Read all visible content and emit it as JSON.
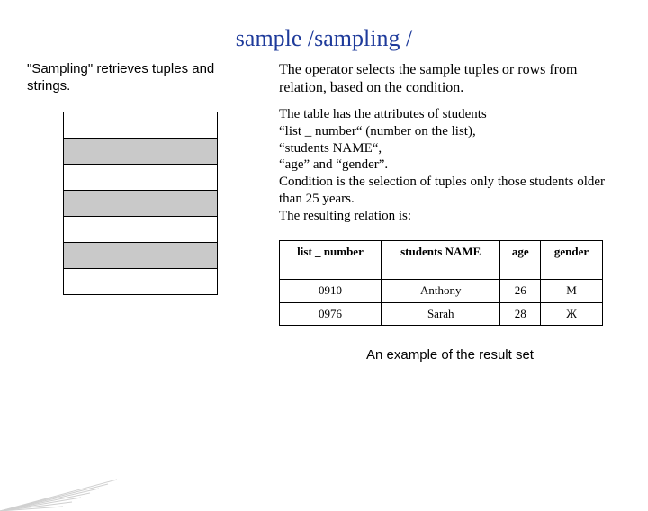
{
  "title": "sample /sampling /",
  "left_text": "\"Sampling\" retrieves tuples and strings.",
  "right_intro": "The operator selects the sample tuples or rows from relation, based on the condition.",
  "right_para2_lines": [
    "The table has the attributes of students",
    "“list _ number“ (number on the list),",
    "“students NAME“,",
    "“age” and “gender”.",
    " Condition is the selection of tuples only those students older than 25 years.",
    " The resulting relation is:"
  ],
  "table": {
    "headers": [
      "list _ number",
      "students NAME",
      "age",
      "gender"
    ],
    "rows": [
      [
        "0910",
        "Anthony",
        "26",
        "М"
      ],
      [
        "0976",
        "Sarah",
        "28",
        "Ж"
      ]
    ]
  },
  "caption": "An example of the result set"
}
